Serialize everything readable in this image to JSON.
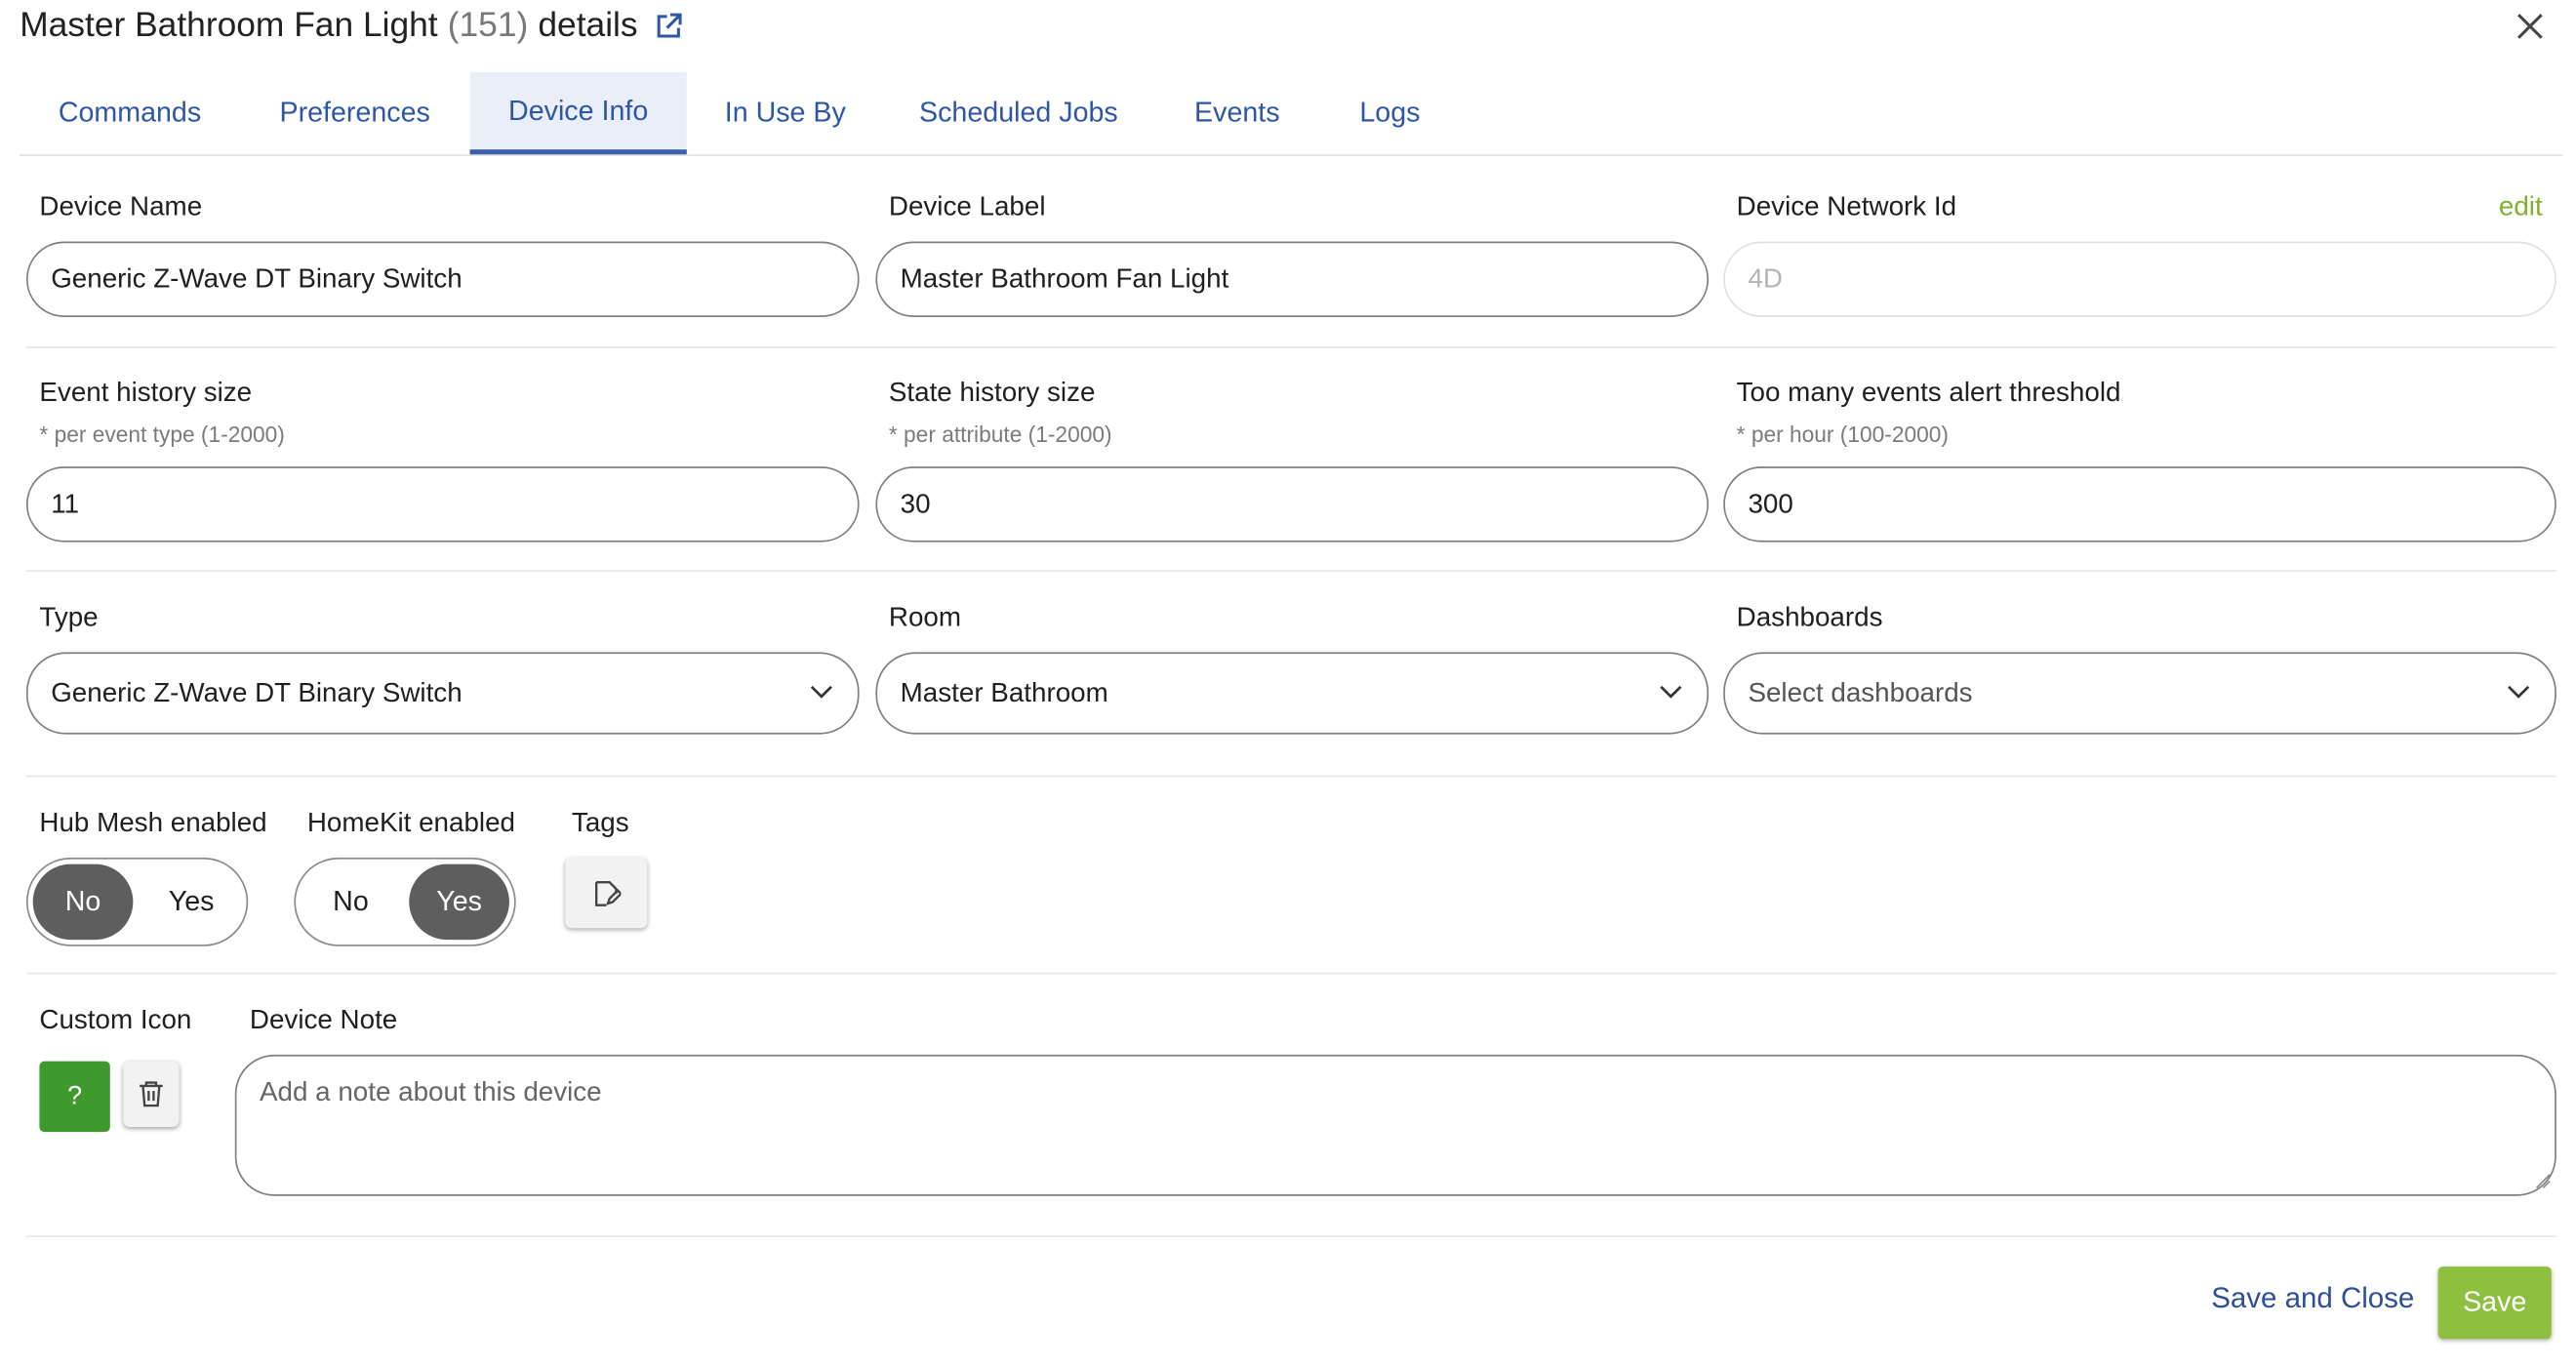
{
  "header": {
    "title": "Master Bathroom Fan Light",
    "count": "(151)",
    "suffix": "details"
  },
  "tabs": [
    {
      "label": "Commands",
      "active": false
    },
    {
      "label": "Preferences",
      "active": false
    },
    {
      "label": "Device Info",
      "active": true
    },
    {
      "label": "In Use By",
      "active": false
    },
    {
      "label": "Scheduled Jobs",
      "active": false
    },
    {
      "label": "Events",
      "active": false
    },
    {
      "label": "Logs",
      "active": false
    }
  ],
  "device_name": {
    "label": "Device Name",
    "value": "Generic Z-Wave DT Binary Switch"
  },
  "device_label": {
    "label": "Device Label",
    "value": "Master Bathroom Fan Light"
  },
  "network_id": {
    "label": "Device Network Id",
    "edit": "edit",
    "value": "4D"
  },
  "event_history": {
    "label": "Event history size",
    "hint": "* per event type (1-2000)",
    "value": "11"
  },
  "state_history": {
    "label": "State history size",
    "hint": "* per attribute (1-2000)",
    "value": "30"
  },
  "alert_threshold": {
    "label": "Too many events alert threshold",
    "hint": "* per hour (100-2000)",
    "value": "300"
  },
  "type": {
    "label": "Type",
    "value": "Generic Z-Wave DT Binary Switch"
  },
  "room": {
    "label": "Room",
    "value": "Master Bathroom"
  },
  "dashboards": {
    "label": "Dashboards",
    "placeholder": "Select dashboards"
  },
  "hub_mesh": {
    "label": "Hub Mesh enabled",
    "no": "No",
    "yes": "Yes",
    "selected": "No"
  },
  "homekit": {
    "label": "HomeKit enabled",
    "no": "No",
    "yes": "Yes",
    "selected": "Yes"
  },
  "tags": {
    "label": "Tags"
  },
  "custom_icon": {
    "label": "Custom Icon",
    "glyph": "?"
  },
  "device_note": {
    "label": "Device Note",
    "placeholder": "Add a note about this device"
  },
  "footer": {
    "save_close": "Save and Close",
    "save": "Save"
  },
  "colors": {
    "accent": "#2d56a6",
    "green": "#3e9a2d",
    "save_green": "#8fbf3f",
    "edit_green": "#7fb12e",
    "toggle_on": "#5e5e5e"
  }
}
